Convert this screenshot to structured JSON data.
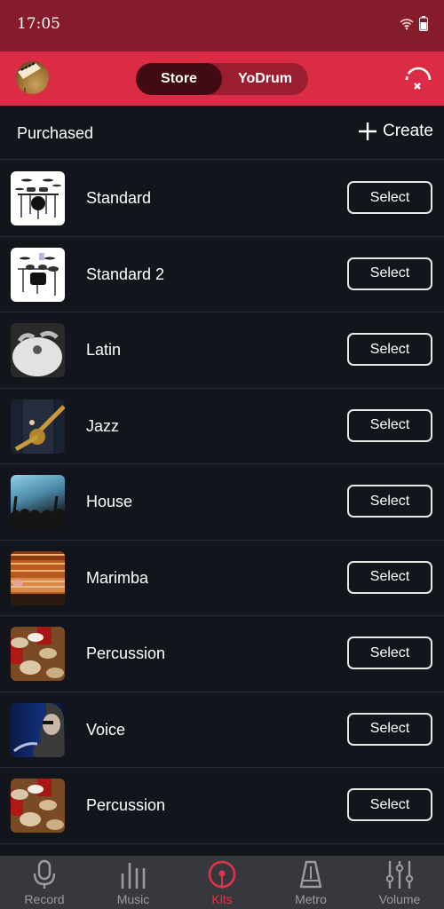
{
  "status_bar": {
    "time": "17:05",
    "wifi_icon": "wifi-icon",
    "battery_icon": "battery-icon"
  },
  "header": {
    "avatar_icon": "piano-avatar",
    "tabs": [
      {
        "label": "Store",
        "active": true
      },
      {
        "label": "YoDrum",
        "active": false
      }
    ],
    "connection_icon": "disconnected-icon"
  },
  "section": {
    "title": "Purchased",
    "create_label": "Create"
  },
  "kits": [
    {
      "name": "Standard",
      "button": "Select",
      "thumb": "drum-kit"
    },
    {
      "name": "Standard 2",
      "button": "Select",
      "thumb": "drum-kit-2"
    },
    {
      "name": "Latin",
      "button": "Select",
      "thumb": "bongo"
    },
    {
      "name": "Jazz",
      "button": "Select",
      "thumb": "saxophone"
    },
    {
      "name": "House",
      "button": "Select",
      "thumb": "concert"
    },
    {
      "name": "Marimba",
      "button": "Select",
      "thumb": "marimba"
    },
    {
      "name": "Percussion",
      "button": "Select",
      "thumb": "congas"
    },
    {
      "name": "Voice",
      "button": "Select",
      "thumb": "singer"
    },
    {
      "name": "Percussion",
      "button": "Select",
      "thumb": "congas"
    }
  ],
  "tabbar": {
    "items": [
      {
        "label": "Record",
        "icon": "microphone-icon",
        "active": false
      },
      {
        "label": "Music",
        "icon": "bars-icon",
        "active": false
      },
      {
        "label": "Kits",
        "icon": "drumstick-icon",
        "active": true
      },
      {
        "label": "Metro",
        "icon": "metronome-icon",
        "active": false
      },
      {
        "label": "Volume",
        "icon": "mixer-icon",
        "active": false
      }
    ]
  },
  "colors": {
    "accent": "#dc2b45",
    "status_bar": "#861b2b",
    "background": "#12161c",
    "tabbar": "#36383e",
    "active_tab": "#e33148"
  }
}
